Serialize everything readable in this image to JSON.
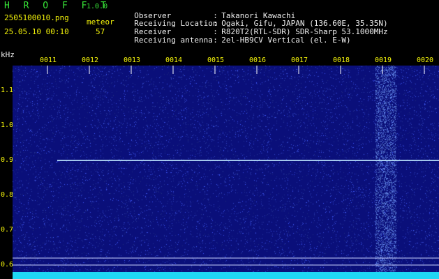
{
  "header": {
    "app_title": "H R O F F T",
    "app_version": "1.0.0",
    "file_name": "2505100010.png",
    "datetime": "25.05.10 00:10",
    "detect_label": "meteor",
    "detect_count": "57"
  },
  "info": [
    {
      "key": "Observer",
      "sep": ":",
      "value": "Takanori Kawachi"
    },
    {
      "key": "Receiving Location",
      "sep": ":",
      "value": "Ogaki, Gifu, JAPAN (136.60E, 35.35N)"
    },
    {
      "key": "Receiver",
      "sep": ":",
      "value": "R820T2(RTL-SDR) SDR-Sharp 53.1000MHz"
    },
    {
      "key": "Receiving antenna",
      "sep": ":",
      "value": "2el-HB9CV Vertical (el. E-W)"
    }
  ],
  "axis": {
    "y_unit": "kHz",
    "time_ticks": [
      "0011",
      "0012",
      "0013",
      "0014",
      "0015",
      "0016",
      "0017",
      "0018",
      "0019",
      "0020"
    ],
    "freq_ticks": [
      "1.1",
      "1.0",
      "0.9",
      "0.8",
      "0.7",
      "0.6"
    ]
  },
  "colors": {
    "background": "#0a0f7a",
    "header_text": "#f5f50a",
    "info_text": "#f0f0f0",
    "title_text": "#38e638",
    "carrier_line": "#bfe8ff",
    "bottom_band": "#1fd7f5"
  }
}
